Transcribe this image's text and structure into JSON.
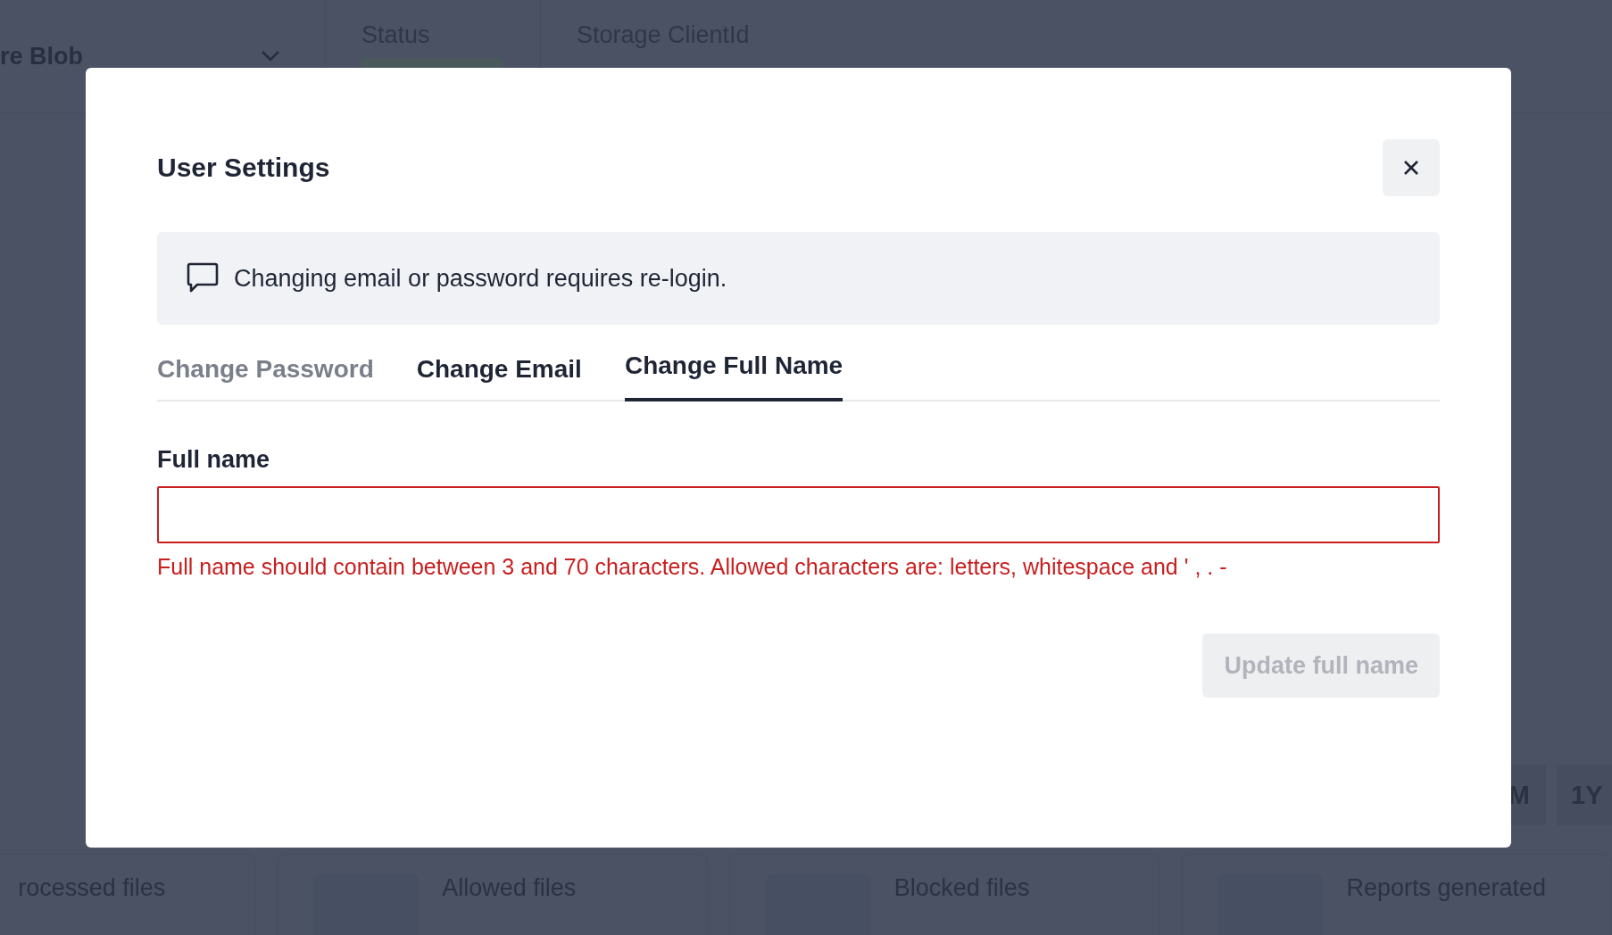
{
  "background": {
    "source_select": {
      "value": "re Blob"
    },
    "header_fields": [
      {
        "label": "Status"
      },
      {
        "label": "Storage ClientId"
      }
    ],
    "range_buttons": [
      "M",
      "1Y"
    ],
    "stat_cards": [
      "rocessed files",
      "Allowed files",
      "Blocked files",
      "Reports generated"
    ]
  },
  "dialog": {
    "title": "User Settings",
    "notice": "Changing email or password requires re-login.",
    "tabs": [
      {
        "label": "Change Password",
        "selected": false,
        "disabled": true
      },
      {
        "label": "Change Email",
        "selected": false,
        "disabled": false
      },
      {
        "label": "Change Full Name",
        "selected": true,
        "disabled": false
      }
    ],
    "field": {
      "label": "Full name",
      "invalid": true,
      "error": "Full name should contain between 3 and 70 characters. Allowed characters are: letters, whitespace and ' , . -"
    },
    "submit": {
      "label": "Update full name",
      "disabled": true
    }
  }
}
